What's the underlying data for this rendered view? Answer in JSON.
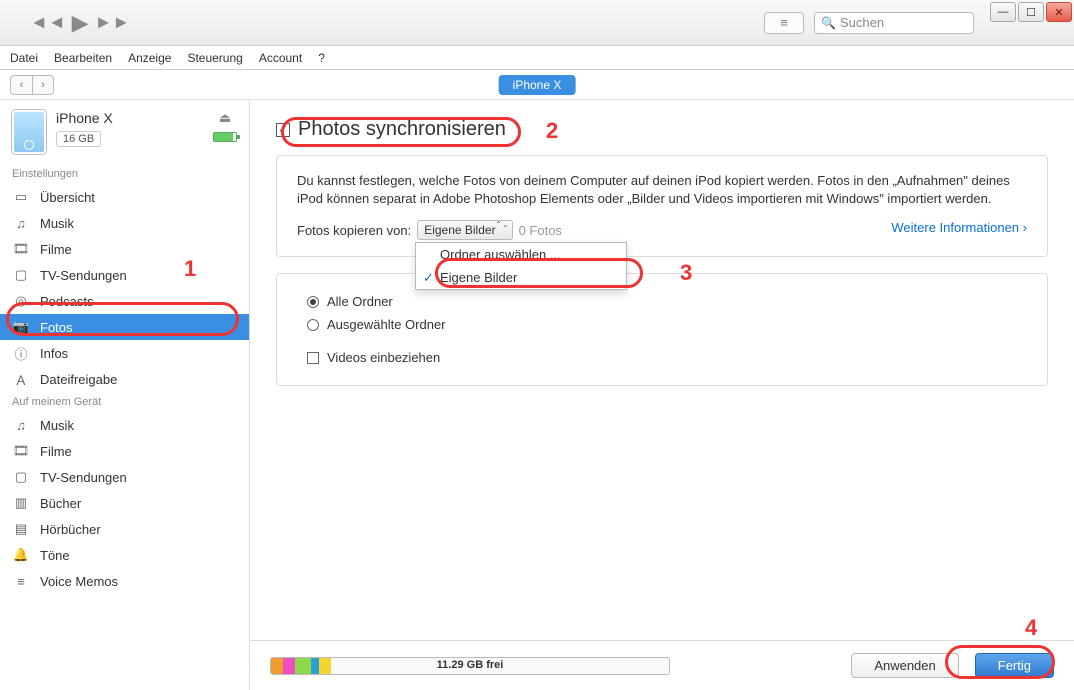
{
  "menus": {
    "datei": "Datei",
    "bearbeiten": "Bearbeiten",
    "anzeige": "Anzeige",
    "steuerung": "Steuerung",
    "account": "Account",
    "help": "?"
  },
  "search_placeholder": "Suchen",
  "device_pill": "iPhone X",
  "device": {
    "name": "iPhone X",
    "capacity": "16 GB"
  },
  "sections": {
    "settings": "Einstellungen",
    "ondevice": "Auf meinem Gerät"
  },
  "sidebar_settings": {
    "overview": "Übersicht",
    "music": "Musik",
    "movies": "Filme",
    "tvshows": "TV-Sendungen",
    "podcasts": "Podcasts",
    "photos": "Fotos",
    "info": "Infos",
    "filesharing": "Dateifreigabe"
  },
  "sidebar_device": {
    "music": "Musik",
    "movies": "Filme",
    "tvshows": "TV-Sendungen",
    "books": "Bücher",
    "audiobooks": "Hörbücher",
    "tones": "Töne",
    "voicememos": "Voice Memos"
  },
  "heading": "Photos synchronisieren",
  "intro": "Du kannst festlegen, welche Fotos von deinem Computer auf deinen iPod kopiert werden. Fotos in den „Aufnahmen\" deines iPod können separat in Adobe Photoshop Elements oder „Bilder und Videos importieren mit Windows\" importiert werden.",
  "copy_from_label": "Fotos kopieren von:",
  "combo_value": "Eigene Bilder",
  "photo_count": "0 Fotos",
  "more_info": "Weitere Informationen",
  "dd": {
    "choose": "Ordner auswählen ...",
    "pictures": "Eigene Bilder"
  },
  "radio_all": "Alle Ordner",
  "radio_selected": "Ausgewählte Ordner",
  "include_videos": "Videos einbeziehen",
  "free_space": "11.29 GB frei",
  "btn_apply": "Anwenden",
  "btn_done": "Fertig",
  "cap_colors": {
    "orange": "#f29b2e",
    "pink": "#ed4fc1",
    "green": "#8cd94a",
    "blue": "#2aa0d6",
    "yellow": "#f4d431"
  },
  "annotations": {
    "n1": "1",
    "n2": "2",
    "n3": "3",
    "n4": "4"
  }
}
